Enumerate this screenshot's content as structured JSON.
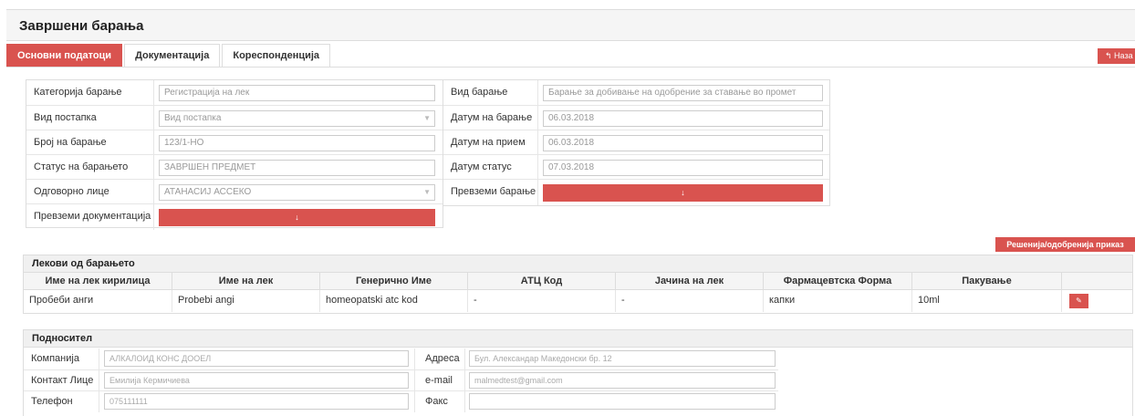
{
  "page": {
    "title": "Завршени барања"
  },
  "tabs": [
    {
      "label": "Основни податоци",
      "active": true
    },
    {
      "label": "Документација",
      "active": false
    },
    {
      "label": "Кореспонденција",
      "active": false
    }
  ],
  "back_button": {
    "icon": "reply-icon",
    "label": "↰ Наза"
  },
  "form": {
    "left": [
      {
        "label": "Категорија барање",
        "value": "Регистрација на  лек",
        "type": "text"
      },
      {
        "label": "Вид постапка",
        "value": "Вид постапка",
        "type": "select"
      },
      {
        "label": "Број на барање",
        "value": "123/1-НО",
        "type": "text"
      },
      {
        "label": "Статус на барањето",
        "value": "ЗАВРШЕН ПРЕДМЕТ",
        "type": "text"
      },
      {
        "label": "Одговорно лице",
        "value": "АТАНАСИЈ АССЕКО",
        "type": "select"
      },
      {
        "label": "Превземи документација",
        "button": "↓",
        "type": "button"
      }
    ],
    "right": [
      {
        "label": "Вид барање",
        "value": "Барање за добивање на одобрение за ставање во промет",
        "type": "text"
      },
      {
        "label": "Датум на барање",
        "value": "06.03.2018",
        "type": "text"
      },
      {
        "label": "Датум на прием",
        "value": "06.03.2018",
        "type": "text"
      },
      {
        "label": "Датум статус",
        "value": "07.03.2018",
        "type": "text"
      },
      {
        "label": "Превземи барање",
        "button": "↓",
        "type": "button"
      }
    ]
  },
  "decisions_button": {
    "label": "Решенија/одобренија приказ"
  },
  "medicines": {
    "title": "Лекови од барањето",
    "columns": [
      "Име на лек кирилица",
      "Име на лек",
      "Генерично Име",
      "АТЦ Код",
      "Јачина на лек",
      "Фармацевтска Форма",
      "Пакување",
      ""
    ],
    "rows": [
      {
        "cells": [
          "Пробеби анги",
          "Probebi angi",
          "homeopatski atc kod",
          "-",
          "-",
          "капки",
          "10ml"
        ],
        "action_icon": "edit-icon",
        "action_label": "✎"
      }
    ]
  },
  "submitter": {
    "title": "Подносител",
    "rows": [
      {
        "label_left": "Компанија",
        "value_left": "АЛКАЛОИД КОНС ДООЕЛ",
        "label_right": "Адреса",
        "value_right": "Бул. Александар Македонски бр. 12"
      },
      {
        "label_left": "Контакт Лице",
        "value_left": "Емилија Кермичиева",
        "label_right": "e-mail",
        "value_right": "malmedtest@gmail.com"
      },
      {
        "label_left": "Телефон",
        "value_left": "075111111",
        "label_right": "Факс",
        "value_right": ""
      }
    ]
  },
  "colors": {
    "accent": "#d9534f",
    "border": "#dddddd",
    "header_bg": "#f5f5f5"
  }
}
